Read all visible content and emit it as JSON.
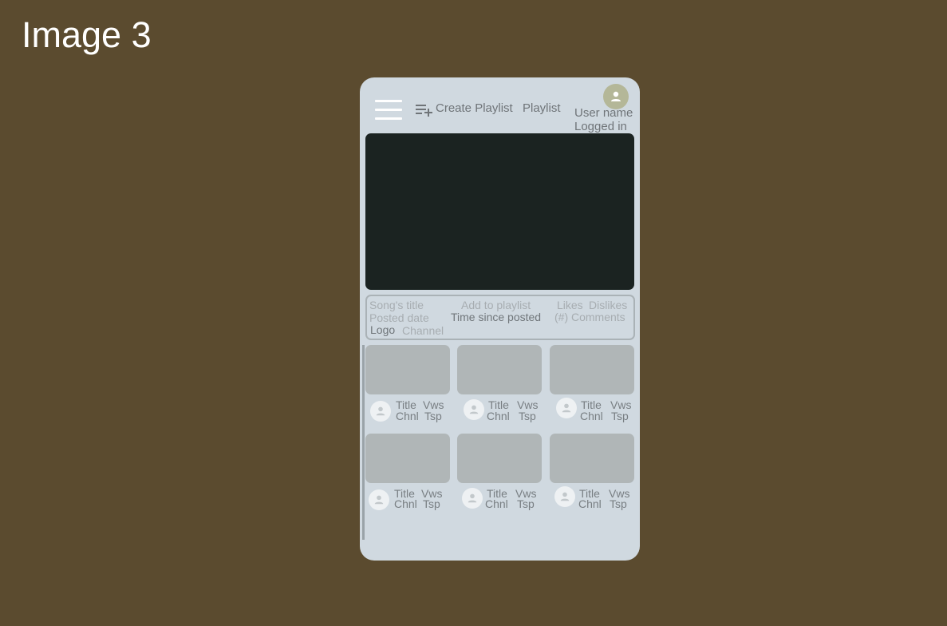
{
  "caption": "Image 3",
  "header": {
    "menu_icon": "hamburger-menu-icon",
    "create_playlist_icon": "playlist-add-icon",
    "create_playlist_label": "Create Playlist",
    "playlist_label": "Playlist",
    "user_avatar_icon": "person-icon",
    "user_name": "User name",
    "login_status": "Logged in"
  },
  "video_info": {
    "song_title": "Song's title",
    "posted_date": "Posted date",
    "logo": "Logo",
    "channel": "Channel",
    "add_to_playlist": "Add to playlist",
    "time_since_posted": "Time since posted",
    "likes": "Likes",
    "dislikes": "Dislikes",
    "comments": "(#) Comments"
  },
  "cards": [
    {
      "title": "Title",
      "views": "Vws",
      "channel": "Chnl",
      "timestamp": "Tsp"
    },
    {
      "title": "Title",
      "views": "Vws",
      "channel": "Chnl",
      "timestamp": "Tsp"
    },
    {
      "title": "Title",
      "views": "Vws",
      "channel": "Chnl",
      "timestamp": "Tsp"
    },
    {
      "title": "Title",
      "views": "Vws",
      "channel": "Chnl",
      "timestamp": "Tsp"
    },
    {
      "title": "Title",
      "views": "Vws",
      "channel": "Chnl",
      "timestamp": "Tsp"
    },
    {
      "title": "Title",
      "views": "Vws",
      "channel": "Chnl",
      "timestamp": "Tsp"
    }
  ],
  "colors": {
    "background": "#5b4b2f",
    "phone": "#d0d9e0",
    "video": "#1b2321",
    "thumbnail": "#b0b6b7",
    "avatar_top": "#b4b798"
  }
}
